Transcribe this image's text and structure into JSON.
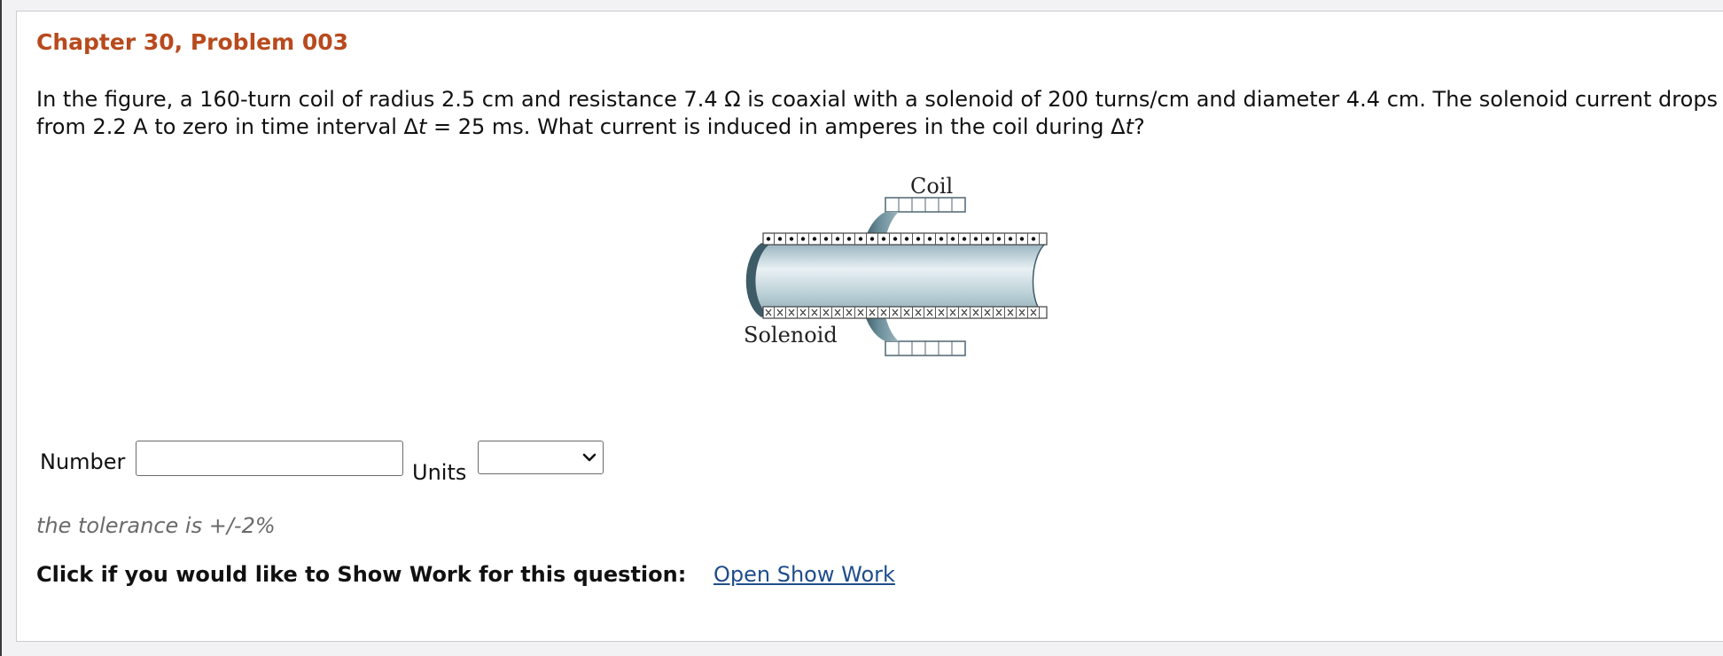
{
  "problem": {
    "title": "Chapter 30, Problem 003",
    "text_part1": "In the figure, a 160-turn coil of radius 2.5 cm and resistance 7.4 Ω is coaxial with a solenoid of 200 turns/cm and diameter 4.4 cm. The solenoid current drops from 2.2 A to zero in time interval Δ",
    "var_t1": "t",
    "text_part2": " = 25 ms. What current is induced in amperes in the coil during Δ",
    "var_t2": "t",
    "text_part3": "?"
  },
  "figure": {
    "coil_label": "Coil",
    "solenoid_label": "Solenoid"
  },
  "answer": {
    "number_label": "Number",
    "number_value": "",
    "units_label": "Units",
    "units_selected": ""
  },
  "tolerance_text": "the tolerance is +/-2%",
  "show_work": {
    "prompt": "Click if you would like to Show Work for this question:",
    "link_label": "Open Show Work"
  },
  "colors": {
    "title": "#b84a1d",
    "link": "#1f4d8c",
    "solenoid_steel": "#4f7180"
  }
}
